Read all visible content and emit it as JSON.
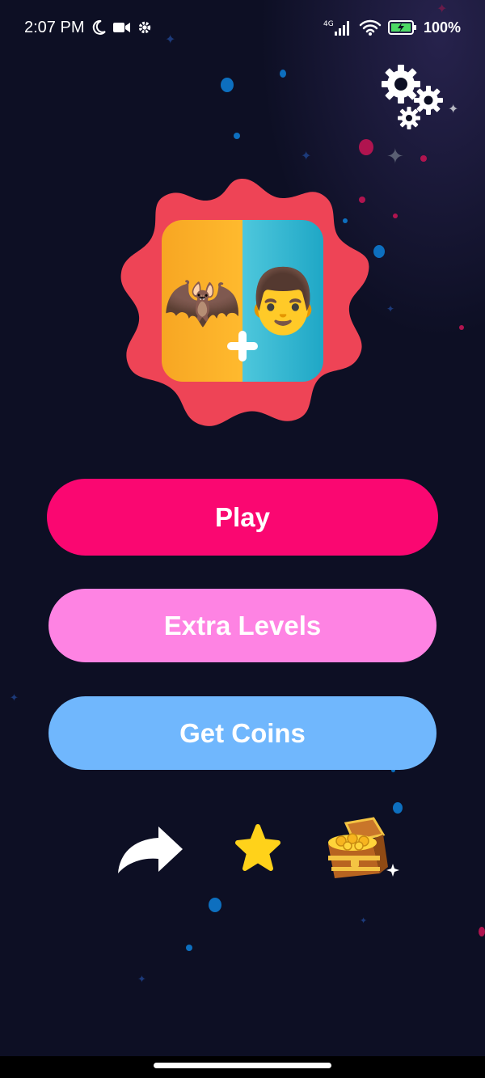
{
  "status_bar": {
    "time": "2:07 PM",
    "network": "4G",
    "battery_pct": "100%",
    "icons_left": [
      "moon-icon",
      "video-camera-icon",
      "gear-icon"
    ],
    "icons_right": [
      "signal-icon",
      "wifi-icon",
      "battery-charging-icon"
    ]
  },
  "header": {
    "settings_icon": "gears-icon"
  },
  "logo": {
    "left_emoji": "🦇",
    "right_emoji": "👨",
    "plus_icon": "plus-icon",
    "colors": {
      "burst": "#ee4456",
      "left": "#ffb22a",
      "right": "#2fb6d2"
    }
  },
  "menu": {
    "play_label": "Play",
    "extra_levels_label": "Extra Levels",
    "get_coins_label": "Get Coins",
    "colors": {
      "play": "#fa0771",
      "extra": "#fe83e3",
      "coins": "#70b7fd"
    }
  },
  "bottom_bar": {
    "share_icon": "share-arrow-icon",
    "rate_icon": "star-icon",
    "shop_icon": "treasure-chest-icon"
  },
  "colors": {
    "background": "#0d0f24"
  }
}
